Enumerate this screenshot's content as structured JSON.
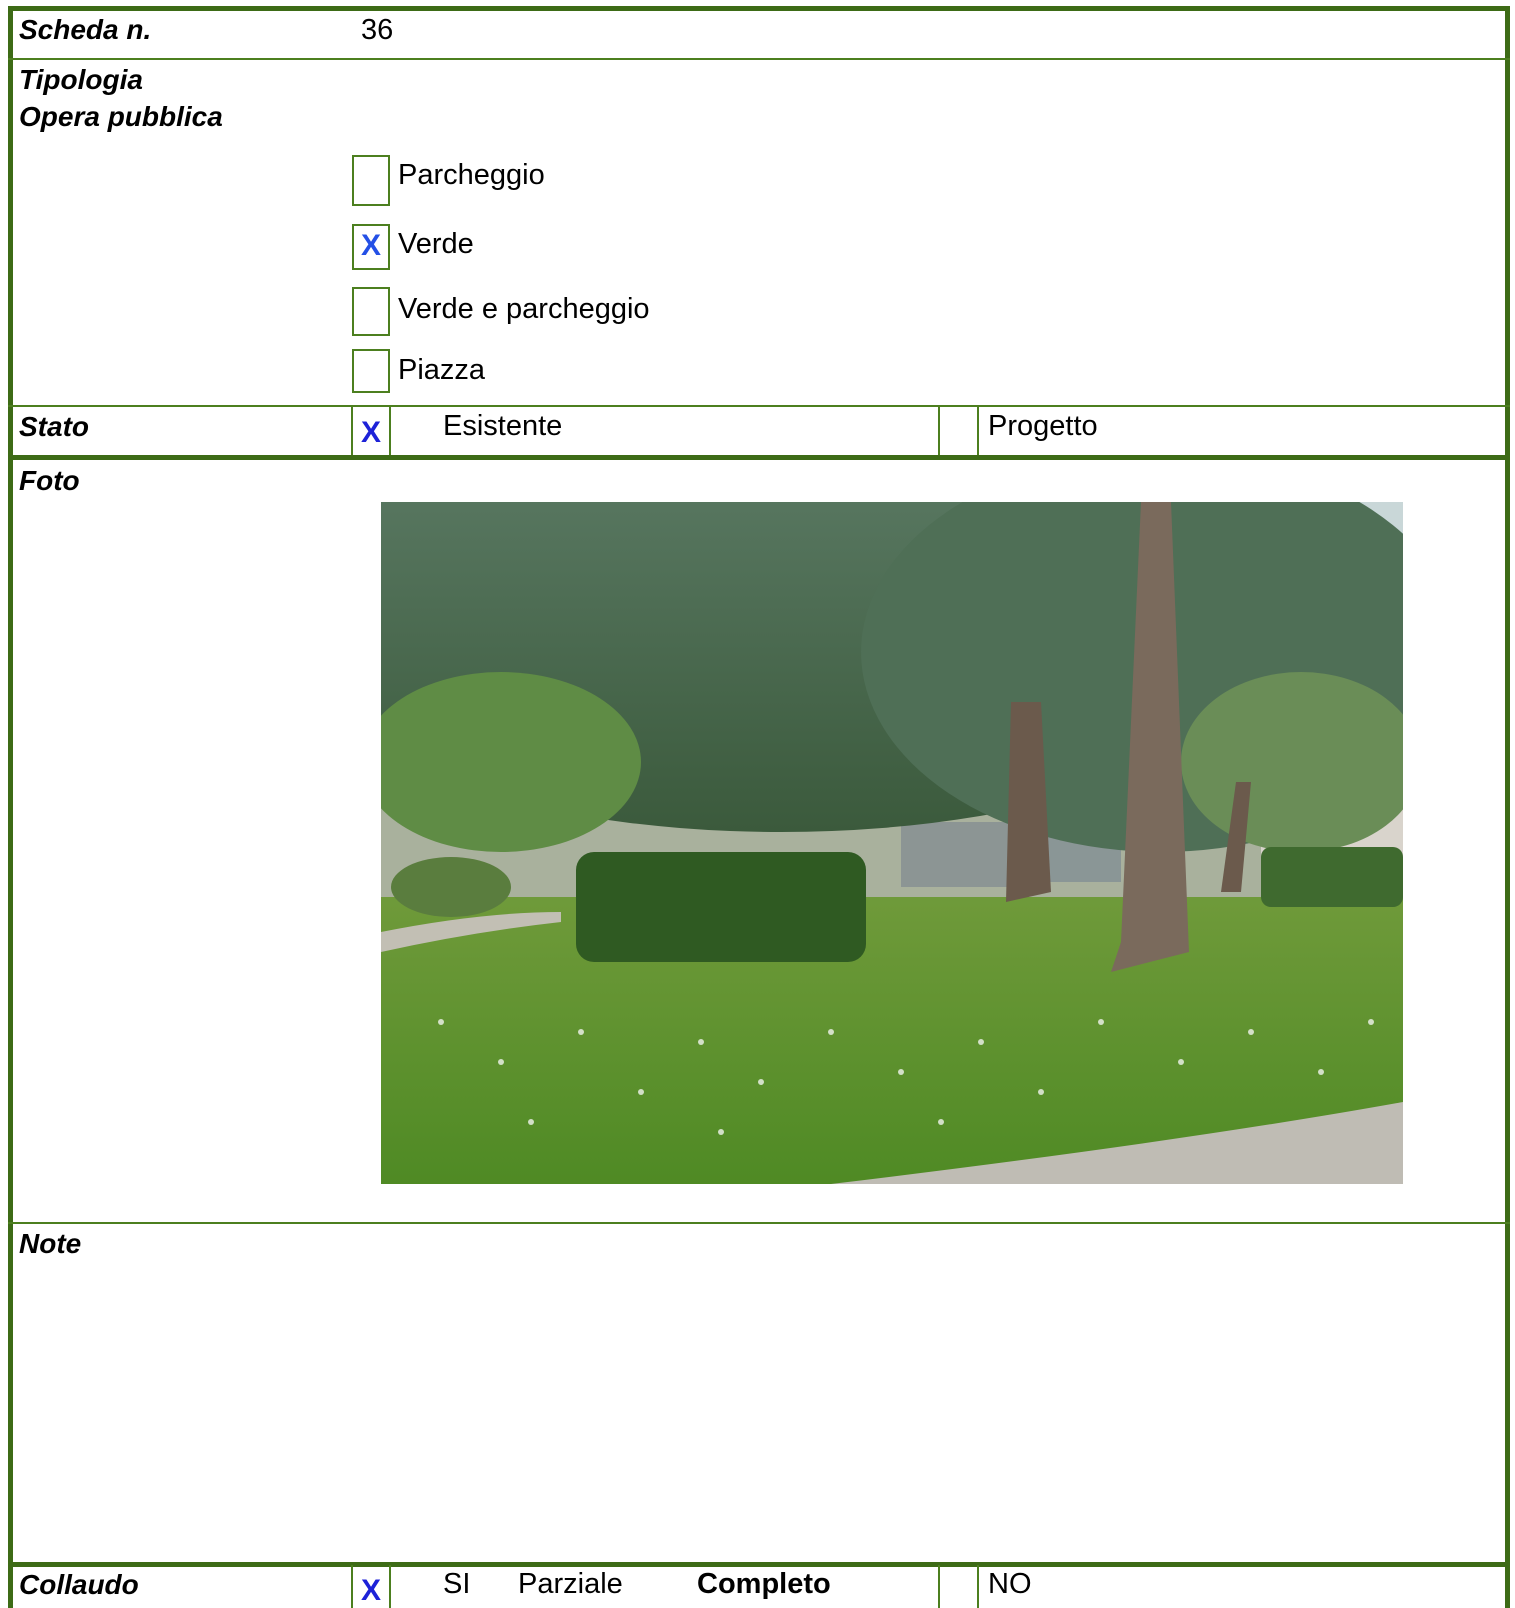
{
  "scheda": {
    "label": "Scheda n.",
    "value": "36"
  },
  "tipologia": {
    "label_line1": "Tipologia",
    "label_line2": "Opera pubblica",
    "options": [
      {
        "label": "Parcheggio",
        "checked": false,
        "mark": ""
      },
      {
        "label": "Verde",
        "checked": true,
        "mark": "X"
      },
      {
        "label": "Verde e parcheggio",
        "checked": false,
        "mark": ""
      },
      {
        "label": "Piazza",
        "checked": false,
        "mark": ""
      }
    ]
  },
  "stato": {
    "label": "Stato",
    "mark": "X",
    "esistente": "Esistente",
    "progetto": "Progetto"
  },
  "foto": {
    "label": "Foto"
  },
  "note": {
    "label": "Note"
  },
  "collaudo": {
    "label": "Collaudo",
    "mark": "X",
    "si": "SI",
    "parziale": "Parziale",
    "completo": "Completo",
    "no": "NO"
  },
  "colors": {
    "border": "#3d6b16",
    "check_mark": "#2450e6"
  }
}
